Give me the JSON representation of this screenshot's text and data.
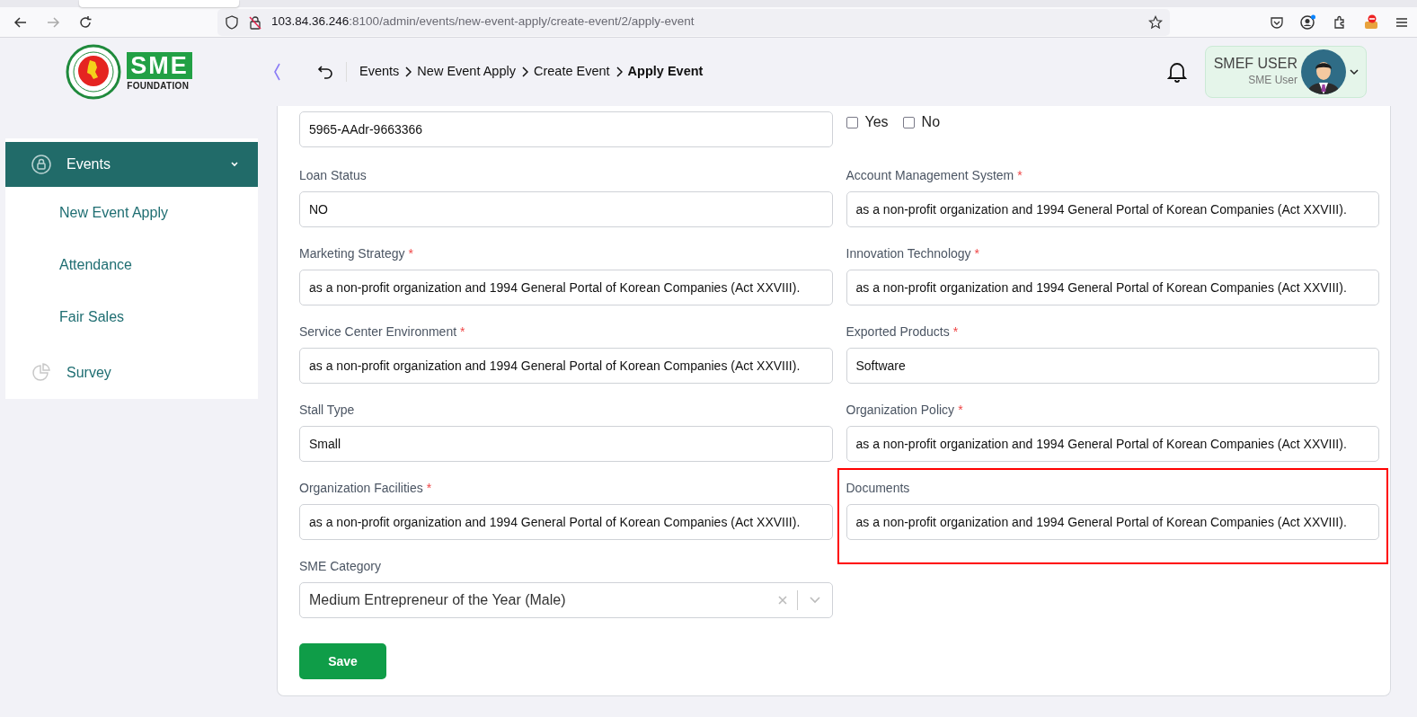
{
  "browser": {
    "url_host": "103.84.36.246",
    "url_path": ":8100/admin/events/new-event-apply/create-event/2/apply-event"
  },
  "logo": {
    "letters": "SME",
    "caption": "FOUNDATION"
  },
  "breadcrumb": [
    {
      "label": "Events",
      "current": false
    },
    {
      "label": "New Event Apply",
      "current": false
    },
    {
      "label": "Create Event",
      "current": false
    },
    {
      "label": "Apply Event",
      "current": true
    }
  ],
  "user": {
    "name": "SMEF USER",
    "role": "SME User"
  },
  "sidebar": {
    "items": [
      {
        "label": "Events",
        "selected": true,
        "expanded": true,
        "children": [
          {
            "label": "New Event Apply"
          },
          {
            "label": "Attendance"
          },
          {
            "label": "Fair Sales"
          }
        ]
      },
      {
        "label": "Survey",
        "selected": false
      }
    ]
  },
  "form": {
    "fields": [
      {
        "kind": "text",
        "value": "5965-AAdr-9663366",
        "highlighted": false
      },
      {
        "kind": "checks",
        "options": [
          {
            "label": "Yes",
            "checked": false
          },
          {
            "label": "No",
            "checked": false
          }
        ]
      },
      {
        "kind": "text",
        "label": "Loan Status",
        "value": "NO",
        "highlighted": false
      },
      {
        "kind": "text",
        "label": "Account Management System",
        "required_mark": "*",
        "value": "as a non-profit organization and 1994 General Portal of Korean Companies (Act XXVIII).",
        "highlighted": false
      },
      {
        "kind": "text",
        "label": "Marketing Strategy",
        "required_mark": "*",
        "value": "as a non-profit organization and 1994 General Portal of Korean Companies (Act XXVIII).",
        "highlighted": false
      },
      {
        "kind": "text",
        "label": "Innovation Technology",
        "required_mark": "*",
        "value": "as a non-profit organization and 1994 General Portal of Korean Companies (Act XXVIII).",
        "highlighted": false
      },
      {
        "kind": "text",
        "label": "Service Center Environment",
        "required_mark": "*",
        "value": "as a non-profit organization and 1994 General Portal of Korean Companies (Act XXVIII).",
        "highlighted": false
      },
      {
        "kind": "text",
        "label": "Exported Products",
        "required_mark": "*",
        "value": "Software",
        "highlighted": false
      },
      {
        "kind": "text",
        "label": "Stall Type",
        "value": "Small",
        "highlighted": false
      },
      {
        "kind": "text",
        "label": "Organization Policy",
        "required_mark": "*",
        "value": "as a non-profit organization and 1994 General Portal of Korean Companies (Act XXVIII).",
        "highlighted": false
      },
      {
        "kind": "text",
        "label": "Organization Facilities",
        "required_mark": "*",
        "value": "as a non-profit organization and 1994 General Portal of Korean Companies (Act XXVIII).",
        "highlighted": false
      },
      {
        "kind": "text",
        "label": "Documents",
        "value": "as a non-profit organization and 1994 General Portal of Korean Companies (Act XXVIII).",
        "highlighted": true
      },
      {
        "kind": "select",
        "label": "SME Category",
        "value": "Medium Entrepreneur of the Year (Male)",
        "highlighted": false
      }
    ],
    "submit": "Save"
  }
}
